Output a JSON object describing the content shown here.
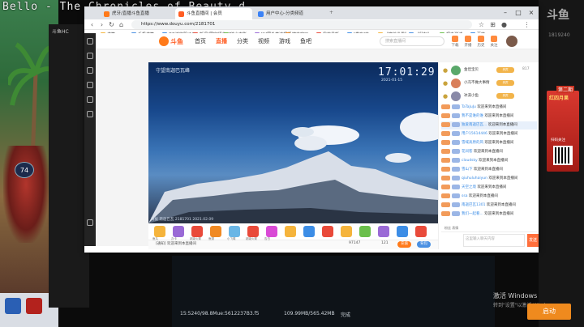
{
  "game": {
    "title": "Bello - The Chronicles of Beauty d",
    "level": "74",
    "taskbar": [
      "",
      "",
      ""
    ]
  },
  "back_window": {
    "title": "斗鱼HC"
  },
  "browser": {
    "tabs": [
      {
        "label": "虎牙/直播斗鱼直播",
        "active": false,
        "color": "#ff7a1a"
      },
      {
        "label": "斗鱼直播间 | 会员",
        "active": true,
        "color": "#ff5d23"
      },
      {
        "label": "用户中心-分类频道",
        "active": false,
        "color": "#3b82f6"
      }
    ],
    "url": "https://www.douyu.com/2181701",
    "bookmarks": [
      {
        "label": "书签",
        "color": "#f5b43c"
      },
      {
        "label": "手机书签",
        "color": "#4a90e2"
      },
      {
        "label": "QQ浏览器(64)",
        "color": "#3c8de6"
      },
      {
        "label": "新闻(国家频道)(6",
        "color": "#e94a3a"
      },
      {
        "label": "综合电影",
        "color": "#6abf4b"
      },
      {
        "label": "[1]国外高达视频",
        "color": "#9a6ad6"
      },
      {
        "label": "搜索窗口",
        "color": "#f08a24"
      },
      {
        "label": "我的最新",
        "color": "#e94a3a"
      },
      {
        "label": "[发布]中...",
        "color": "#3c8de6"
      },
      {
        "label": "《魔兽世界》",
        "color": "#f5b43c"
      },
      {
        "label": "《鼠标》",
        "color": "#4a90e2"
      },
      {
        "label": "视力测试",
        "color": "#6abf4b"
      },
      {
        "label": "百度",
        "color": "#3c8de6"
      },
      {
        "label": "其他收藏",
        "color": "#f5b43c"
      }
    ]
  },
  "douyu": {
    "logo": "斗鱼",
    "nav": [
      "首页",
      "直播",
      "分类",
      "视频",
      "游戏",
      "鱼吧"
    ],
    "active_nav": "直播",
    "search_placeholder": "搜索直播间",
    "header_icons": [
      "下载",
      "开播",
      "历史",
      "关注"
    ]
  },
  "video": {
    "caption": "守望南迦巴瓦峰",
    "clock": "17:01:29",
    "date": "2021-01-15",
    "bottom_info": "海拔 南迦巴瓦  2181701  2021.02.09"
  },
  "gifts": {
    "items": [
      {
        "label": "鱼丸",
        "color": "#f5b43c"
      },
      {
        "label": "办卡",
        "color": "#9a6ad6"
      },
      {
        "label": "超级火箭",
        "color": "#e94a3a"
      },
      {
        "label": "鱼翅",
        "color": "#f08a24"
      },
      {
        "label": "小飞碟",
        "color": "#6ab6e6"
      },
      {
        "label": "超级火箭",
        "color": "#e94a3a"
      },
      {
        "label": "告白",
        "color": "#d94ad6"
      },
      {
        "label": "",
        "color": "#f5b43c"
      },
      {
        "label": "",
        "color": "#3c8de6"
      },
      {
        "label": "",
        "color": "#e94a3a"
      },
      {
        "label": "",
        "color": "#f5b43c"
      },
      {
        "label": "",
        "color": "#6abf4b"
      },
      {
        "label": "",
        "color": "#9a6ad6"
      },
      {
        "label": "",
        "color": "#3c8de6"
      },
      {
        "label": "",
        "color": "#e94a3a"
      }
    ],
    "below_text": "[通知]   欢迎来到本直播间",
    "counter": "97147",
    "counter2": "121",
    "pill1": "充值",
    "pill2": "背包"
  },
  "chat": {
    "rank": [
      {
        "name": "金佳宝贝",
        "badge": "贵宾",
        "num": "817",
        "color": "#5aa86a"
      },
      {
        "name": "小冯不做大事情",
        "badge": "贵宾",
        "num": "",
        "color": "#d97f5a"
      },
      {
        "name": "冰淇小鱼",
        "badge": "贵宾",
        "num": "",
        "color": "#8a8aa8"
      }
    ],
    "lines": [
      {
        "user": "TaTaJuJu",
        "msg": "欢迎来到本直播间",
        "hl": false
      },
      {
        "user": "我不是谁的谁",
        "msg": "欢迎来到本直播间",
        "hl": false
      },
      {
        "user": "独爱南迦巴瓦...",
        "msg": "欢迎来到本直播间",
        "hl": true
      },
      {
        "user": "用户15614446",
        "msg": "欢迎来到本直播间",
        "hl": false
      },
      {
        "user": "雪域高原的风",
        "msg": "欢迎来到本直播间",
        "hl": false
      },
      {
        "user": "花间客",
        "msg": "欢迎来到本直播间",
        "hl": false
      },
      {
        "user": "cloudsky",
        "msg": "欢迎来到本直播间",
        "hl": false
      },
      {
        "user": "雪山下",
        "msg": "欢迎来到本直播间",
        "hl": false
      },
      {
        "user": "qiuhuluhaiyun",
        "msg": "欢迎来到本直播间",
        "hl": false
      },
      {
        "user": "天空之境",
        "msg": "欢迎来到本直播间",
        "hl": false
      },
      {
        "user": "ssa",
        "msg": "欢迎来到本直播间",
        "hl": false
      },
      {
        "user": "南迦巴瓦1301",
        "msg": "欢迎来到本直播间",
        "hl": false
      },
      {
        "user": "我们一起看...",
        "msg": "欢迎来到本直播间",
        "hl": false
      }
    ],
    "input_placeholder": "这里输入聊天内容",
    "send_label": "发送",
    "toolbar": "粉丝  表情"
  },
  "ad": {
    "badge": "第二期",
    "title": "红四月果",
    "sub": "扫码关注"
  },
  "desktop": {
    "tag": "斗鱼",
    "sub": "1819240",
    "activate": "激活 Windows",
    "activate_sub": "转到\"设置\"以激活 Windows。",
    "launch": "启动"
  },
  "bottom_panel": {
    "stat1": "15:5240/98.8Mue:5612237B3.f5",
    "stat2": "109.99MB/565.42MB",
    "stat3": "完成"
  }
}
